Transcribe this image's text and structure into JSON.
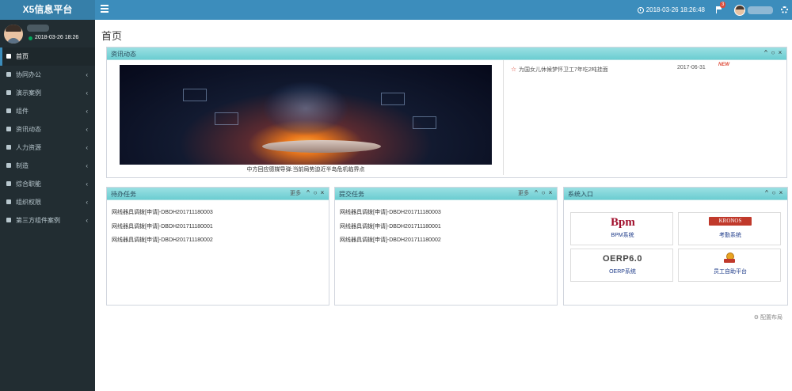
{
  "header": {
    "logo": "X5信息平台",
    "datetime": "2018-03-26 18:26:48",
    "notification_count": "3"
  },
  "sidebar": {
    "user_date": "2018-03-26 18:26",
    "items": [
      {
        "label": "首页"
      },
      {
        "label": "协同办公"
      },
      {
        "label": "演示案例"
      },
      {
        "label": "组件"
      },
      {
        "label": "资讯动态"
      },
      {
        "label": "人力资源"
      },
      {
        "label": "制造"
      },
      {
        "label": "综合职能"
      },
      {
        "label": "组织权限"
      },
      {
        "label": "第三方组件案例"
      }
    ]
  },
  "page": {
    "title": "首页"
  },
  "news": {
    "title": "资讯动态",
    "caption": "中方回应德媒导弹:当前局势迫近半岛危机临界点",
    "item": {
      "title": "为国女儿休候梦怀卫工7年吃2吨挂面",
      "date": "2017-06-31",
      "badge": "NEW"
    }
  },
  "todo": {
    "title": "待办任务",
    "more": "更多",
    "items": [
      "网线器具调拨[申请]-DBDH201711180003",
      "网线器具调拨[申请]-DBDH201711180001",
      "网线器具调拨[申请]-DBDH201711180002"
    ]
  },
  "submitted": {
    "title": "提交任务",
    "more": "更多",
    "items": [
      "网线器具调拨[申请]-DBDH201711180003",
      "网线器具调拨[申请]-DBDH201711180001",
      "网线器具调拨[申请]-DBDH201711180002"
    ]
  },
  "systems": {
    "title": "系统入口",
    "tiles": [
      {
        "logo": "Bpm",
        "label": "BPM系统"
      },
      {
        "logo": "KRONOS",
        "label": "考勤系统"
      },
      {
        "logo": "OERP6.0",
        "label": "OERP系统"
      },
      {
        "label": "员工自助平台"
      }
    ]
  },
  "footer": {
    "config": "配置布局"
  }
}
